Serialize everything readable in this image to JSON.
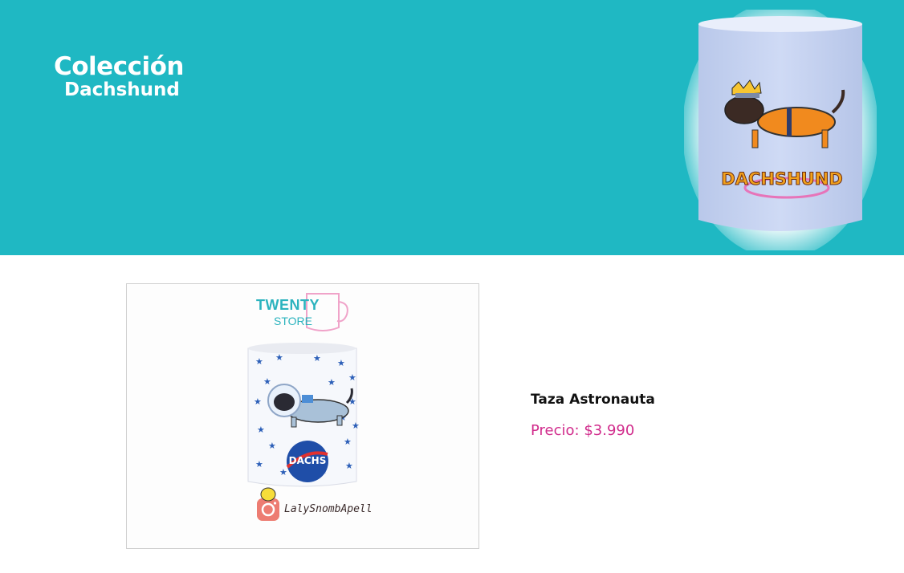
{
  "hero": {
    "title_line1": "Colección",
    "title_line2": "Dachshund",
    "mug_text": "DACHSHUND",
    "background_color": "#1fb8c3"
  },
  "product": {
    "name": "Taza Astronauta",
    "price_label": "Precio: $3.990",
    "price_color": "#d12c8c",
    "image": {
      "store_logo_line1": "TWENTY",
      "store_logo_line2": "STORE",
      "badge_text": "DACHS",
      "instagram_handle": "LalySnombApell"
    }
  }
}
